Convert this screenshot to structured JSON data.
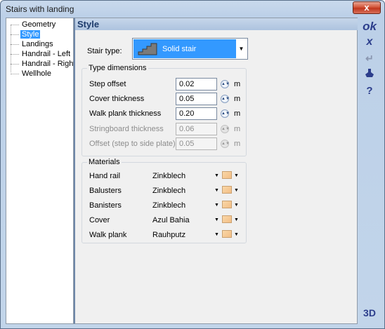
{
  "window": {
    "title": "Stairs with landing",
    "close_label": "x"
  },
  "tree": {
    "items": [
      {
        "label": "Geometry",
        "selected": false
      },
      {
        "label": "Style",
        "selected": true
      },
      {
        "label": "Landings",
        "selected": false
      },
      {
        "label": "Handrail - Left",
        "selected": false
      },
      {
        "label": "Handrail - Right",
        "selected": false
      },
      {
        "label": "Wellhole",
        "selected": false
      }
    ]
  },
  "main": {
    "header": "Style",
    "stair_type": {
      "label": "Stair type:",
      "value": "Solid stair",
      "icon": "solid-stair-icon"
    },
    "dimensions": {
      "title": "Type dimensions",
      "rows": [
        {
          "label": "Step offset",
          "value": "0.02",
          "unit": "m",
          "enabled": true
        },
        {
          "label": "Cover thickness",
          "value": "0.05",
          "unit": "m",
          "enabled": true
        },
        {
          "label": "Walk plank thickness",
          "value": "0.20",
          "unit": "m",
          "enabled": true
        },
        {
          "label": "Stringboard thickness",
          "value": "0.06",
          "unit": "m",
          "enabled": false
        },
        {
          "label": "Offset (step to side plate)",
          "value": "0.05",
          "unit": "m",
          "enabled": false
        }
      ]
    },
    "materials": {
      "title": "Materials",
      "rows": [
        {
          "label": "Hand rail",
          "value": "Zinkblech"
        },
        {
          "label": "Balusters",
          "value": "Zinkblech"
        },
        {
          "label": "Banisters",
          "value": "Zinkblech"
        },
        {
          "label": "Cover",
          "value": "Azul Bahia"
        },
        {
          "label": "Walk plank",
          "value": "Rauhputz"
        }
      ]
    }
  },
  "rightbar": {
    "ok": "ok",
    "cancel": "x",
    "enter": "↵",
    "help": "?",
    "three_d": "3D"
  },
  "colors": {
    "selection": "#3399ff",
    "header_text": "#1d3b6b",
    "accent_blue": "#2c3e8c"
  }
}
